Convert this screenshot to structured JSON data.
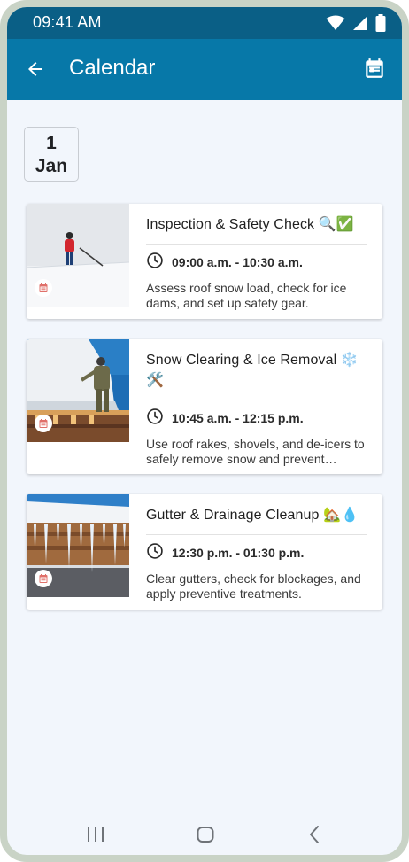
{
  "status_bar": {
    "time": "09:41 AM",
    "icons": [
      "wifi-icon",
      "signal-icon",
      "battery-icon"
    ]
  },
  "app_bar": {
    "title": "Calendar",
    "back_icon": "arrow-left-icon",
    "action_icon": "calendar-icon"
  },
  "date": {
    "day": "1",
    "month": "Jan"
  },
  "events": [
    {
      "title": "Inspection & Safety Check 🔍✅",
      "time": "09:00 a.m. - 10:30 a.m.",
      "description": "Assess roof snow load, check for ice dams, and set up safety gear.",
      "image": "person-raking-snow-on-roof-photo",
      "badge_icon": "calendar-icon"
    },
    {
      "title": "Snow Clearing & Ice Removal ❄️🛠️",
      "time": "10:45 a.m. - 12:15 p.m.",
      "description": "Use roof rakes, shovels, and de-icers to safely remove snow and prevent damage.",
      "image": "worker-on-snowy-roof-photo",
      "badge_icon": "calendar-icon"
    },
    {
      "title": "Gutter & Drainage Cleanup 🏡💧",
      "time": "12:30 p.m. - 01:30 p.m.",
      "description": "Clear gutters, check for blockages, and apply preventive treatments.",
      "image": "icicles-on-roof-edge-photo",
      "badge_icon": "calendar-icon"
    }
  ],
  "nav_bar": {
    "icons": [
      "recent-apps-icon",
      "home-icon",
      "back-icon"
    ]
  },
  "colors": {
    "status_bar": "#0a5f86",
    "app_bar": "#0778a8",
    "background": "#f2f6fc",
    "frame": "#c9d3c6",
    "badge_accent": "#e0706a"
  }
}
